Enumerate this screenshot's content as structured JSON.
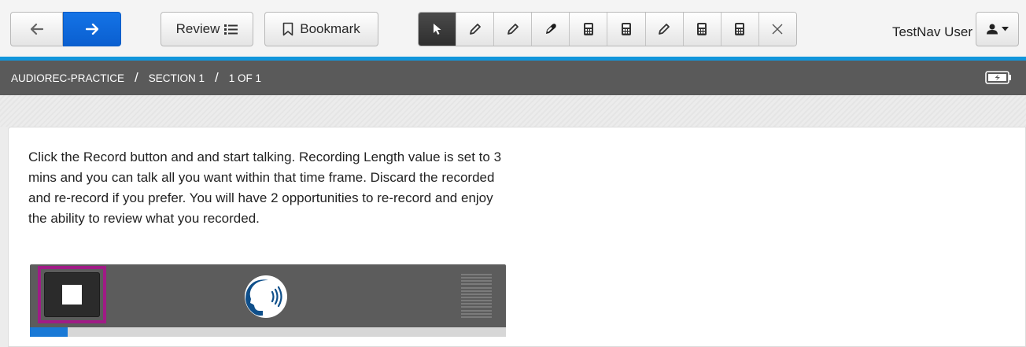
{
  "toolbar": {
    "back_icon": "arrow-left-icon",
    "next_icon": "arrow-right-icon",
    "review_label": "Review",
    "review_icon": "list-icon",
    "bookmark_label": "Bookmark",
    "bookmark_icon": "bookmark-icon",
    "tools": [
      {
        "icon": "pointer-icon",
        "active": true
      },
      {
        "icon": "pencil-icon"
      },
      {
        "icon": "pencil-icon"
      },
      {
        "icon": "eraser-icon"
      },
      {
        "icon": "calculator-icon"
      },
      {
        "icon": "calculator-icon"
      },
      {
        "icon": "pencil-icon"
      },
      {
        "icon": "calculator-icon"
      },
      {
        "icon": "calculator-icon"
      },
      {
        "icon": "close-icon"
      }
    ],
    "user_name": "TestNav User",
    "user_icon": "user-icon"
  },
  "breadcrumb": {
    "items": [
      "AUDIOREC-PRACTICE",
      "SECTION 1",
      "1 OF 1"
    ],
    "separator": "/",
    "battery_icon": "battery-icon"
  },
  "question": {
    "prompt": "Click the Record button and and start talking. Recording Length value is set to 3 mins and you can talk all you want within that time frame. Discard the recorded and re-record if you prefer. You will have 2 opportunities to re-record and enjoy the ability to review what you recorded."
  },
  "recorder": {
    "stop_icon": "stop-icon",
    "speaker_icon": "speaking-head-icon",
    "level_icon": "audio-level-icon",
    "progress_fraction": 0.08,
    "highlight_color": "#a01b86"
  },
  "colors": {
    "accent": "#1296db",
    "primary_button": "#0a5fd0",
    "breadcrumb_bar": "#5a5a5a",
    "recorder_bg": "#5c5c5c",
    "progress": "#1979d6"
  }
}
